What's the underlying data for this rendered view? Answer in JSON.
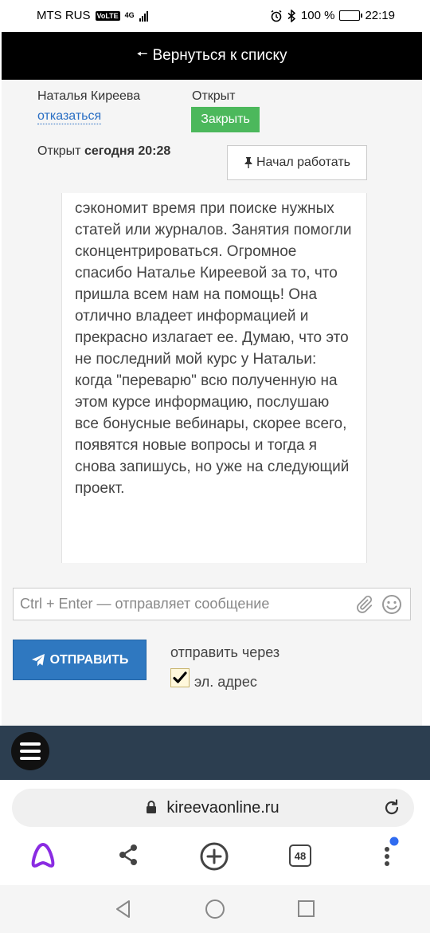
{
  "status_bar": {
    "carrier": "MTS RUS",
    "volte": "VoLTE",
    "network": "4G",
    "battery": "100 %",
    "time": "22:19"
  },
  "header": {
    "back_label": "Вернуться к списку"
  },
  "ticket": {
    "owner": "Наталья Киреева",
    "refuse_link": "отказаться",
    "status": "Открыт",
    "close_button": "Закрыть",
    "opened_prefix": "Открыт",
    "opened_time": "сегодня 20:28",
    "start_button": "Начал работать"
  },
  "message": {
    "text": "сэкономит время при поиске нужных статей или журналов. Занятия помогли сконцентрироваться. Огромное спасибо Наталье Киреевой за то, что пришла всем нам на помощь! Она отлично владеет информацией и прекрасно излагает ее. Думаю, что это не последний мой курс у Натальи: когда \"переварю\" всю полученную на этом курсе информацию, послушаю все бонусные вебинары, скорее всего, появятся новые вопросы и тогда я снова запишусь, но уже на следующий проект."
  },
  "compose": {
    "placeholder": "Ctrl + Enter — отправляет сообщение",
    "send_button": "ОТПРАВИТЬ",
    "send_via_label": "отправить через",
    "email_option": "эл. адрес",
    "email_checked": true
  },
  "browser": {
    "url": "kireevaonline.ru",
    "tab_count": "48"
  },
  "colors": {
    "accent_blue": "#2f78c0",
    "close_green": "#4cb85c",
    "nav_dark": "#2c3e50",
    "alice_purple": "#8a2be2"
  }
}
